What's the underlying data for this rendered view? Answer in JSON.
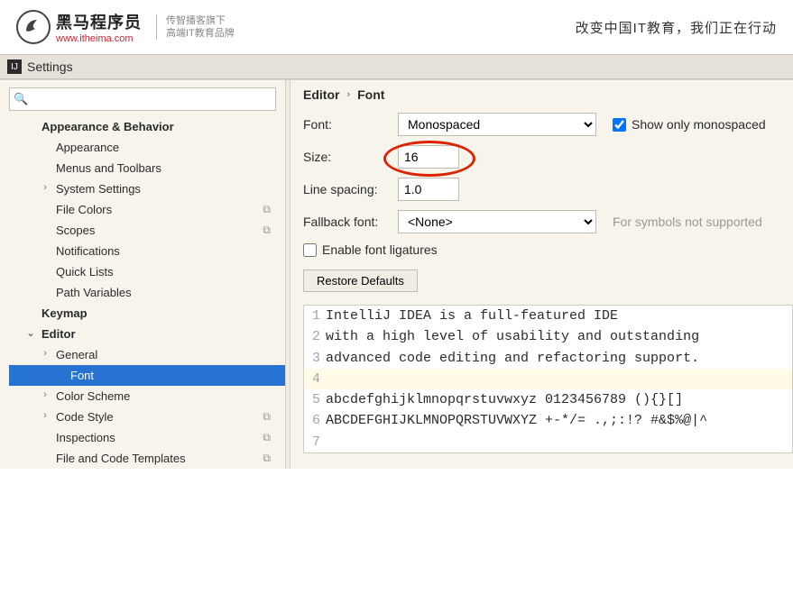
{
  "banner": {
    "brand_main": "黑马程序员",
    "brand_sub": "www.itheima.com",
    "brand_side1": "传智播客旗下",
    "brand_side2": "高端IT教育品牌",
    "slogan": "改变中国IT教育，我们正在行动"
  },
  "window": {
    "title": "Settings"
  },
  "search": {
    "placeholder": ""
  },
  "tree": {
    "appearance_behavior": "Appearance & Behavior",
    "appearance": "Appearance",
    "menus_toolbars": "Menus and Toolbars",
    "system_settings": "System Settings",
    "file_colors": "File Colors",
    "scopes": "Scopes",
    "notifications": "Notifications",
    "quick_lists": "Quick Lists",
    "path_variables": "Path Variables",
    "keymap": "Keymap",
    "editor": "Editor",
    "general": "General",
    "font": "Font",
    "color_scheme": "Color Scheme",
    "code_style": "Code Style",
    "inspections": "Inspections",
    "file_code_templates": "File and Code Templates"
  },
  "breadcrumb": {
    "root": "Editor",
    "leaf": "Font"
  },
  "form": {
    "font_label": "Font:",
    "font_value": "Monospaced",
    "show_mono": "Show only monospaced",
    "size_label": "Size:",
    "size_value": "16",
    "spacing_label": "Line spacing:",
    "spacing_value": "1.0",
    "fallback_label": "Fallback font:",
    "fallback_value": "<None>",
    "fallback_hint": "For symbols not supported",
    "ligatures": "Enable font ligatures",
    "restore": "Restore Defaults"
  },
  "preview": {
    "lines": [
      "IntelliJ IDEA is a full-featured IDE",
      "with a high level of usability and outstanding",
      "advanced code editing and refactoring support.",
      "",
      "abcdefghijklmnopqrstuvwxyz 0123456789 (){}[]",
      "ABCDEFGHIJKLMNOPQRSTUVWXYZ +-*/= .,;:!? #&$%@|^",
      ""
    ]
  }
}
